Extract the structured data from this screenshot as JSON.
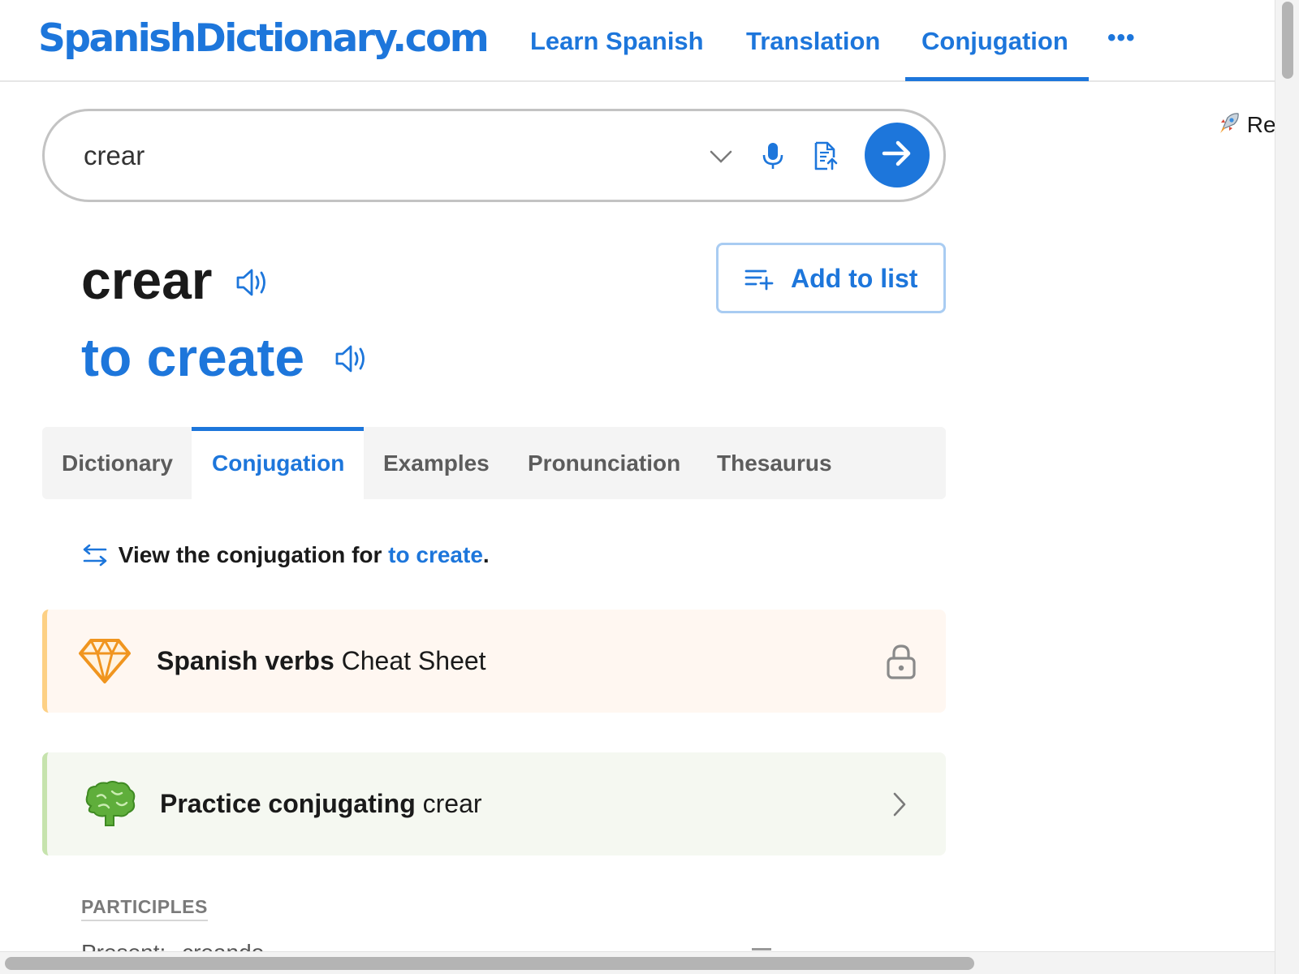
{
  "header": {
    "logo": "SpanishDictionary.com",
    "nav": [
      "Learn Spanish",
      "Translation",
      "Conjugation"
    ],
    "more": "•••"
  },
  "promo": "Re",
  "search": {
    "value": "crear"
  },
  "entry": {
    "headword": "crear",
    "translation": "to create",
    "add_to_list": "Add to list"
  },
  "tabs": [
    "Dictionary",
    "Conjugation",
    "Examples",
    "Pronunciation",
    "Thesaurus"
  ],
  "view_conjugation": {
    "prefix": "View the conjugation for ",
    "link": "to create",
    "suffix": "."
  },
  "cheat_sheet": {
    "bold": "Spanish verbs",
    "rest": " Cheat Sheet"
  },
  "practice": {
    "bold": "Practice conjugating",
    "rest": " crear"
  },
  "participles": {
    "heading": "PARTICIPLES",
    "present_label": "Present:",
    "present_value": "creando"
  },
  "colors": {
    "brand": "#1d76db",
    "cheat_bg": "#fff7f1",
    "practice_bg": "#f5f8f1"
  },
  "icons": [
    "chevron-down-icon",
    "microphone-icon",
    "document-upload-icon",
    "arrow-right-icon",
    "speaker-icon",
    "list-add-icon",
    "swap-arrows-icon",
    "diamond-icon",
    "lock-icon",
    "brain-icon",
    "chevron-right-icon",
    "rocket-icon"
  ]
}
